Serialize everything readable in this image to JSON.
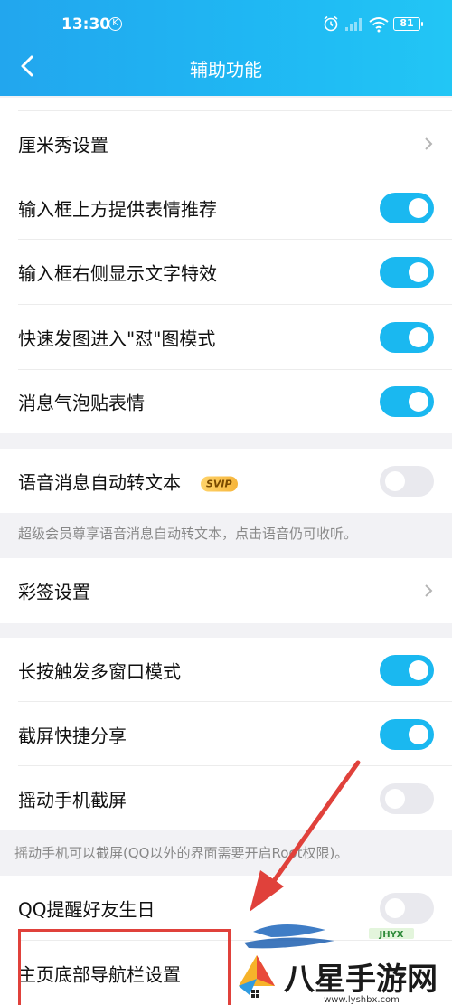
{
  "status_bar": {
    "time": "13:30",
    "k_badge": "K",
    "battery": "81"
  },
  "header": {
    "title": "辅助功能"
  },
  "settings": {
    "cmshow": "厘米秀设置",
    "emoji_suggest": "输入框上方提供表情推荐",
    "text_effect": "输入框右侧显示文字特效",
    "quick_image": "快速发图进入\"怼\"图模式",
    "bubble_sticker": "消息气泡贴表情",
    "voice_to_text": "语音消息自动转文本",
    "svip_badge": "SVIP",
    "voice_note": "超级会员尊享语音消息自动转文本，点击语音仍可收听。",
    "color_sign": "彩签设置",
    "long_press_multiwindow": "长按触发多窗口模式",
    "screenshot_share": "截屏快捷分享",
    "shake_screenshot": "摇动手机截屏",
    "shake_note": "摇动手机可以截屏(QQ以外的界面需要开启Root权限)。",
    "birthday_remind": "QQ提醒好友生日",
    "bottom_nav": "主页底部导航栏设置"
  },
  "toggles": {
    "emoji_suggest": true,
    "text_effect": true,
    "quick_image": true,
    "bubble_sticker": true,
    "voice_to_text": false,
    "long_press_multiwindow": true,
    "screenshot_share": true,
    "shake_screenshot": false,
    "birthday_remind": false
  },
  "watermark": {
    "brand": "八星手游网",
    "url": "www.lyshbx.com",
    "tag": "JHYX"
  },
  "colors": {
    "header": "#1fb2f2",
    "toggle_on": "#1ab8f0",
    "toggle_off": "#e9e9ee",
    "annotation_red": "#e0413b"
  }
}
